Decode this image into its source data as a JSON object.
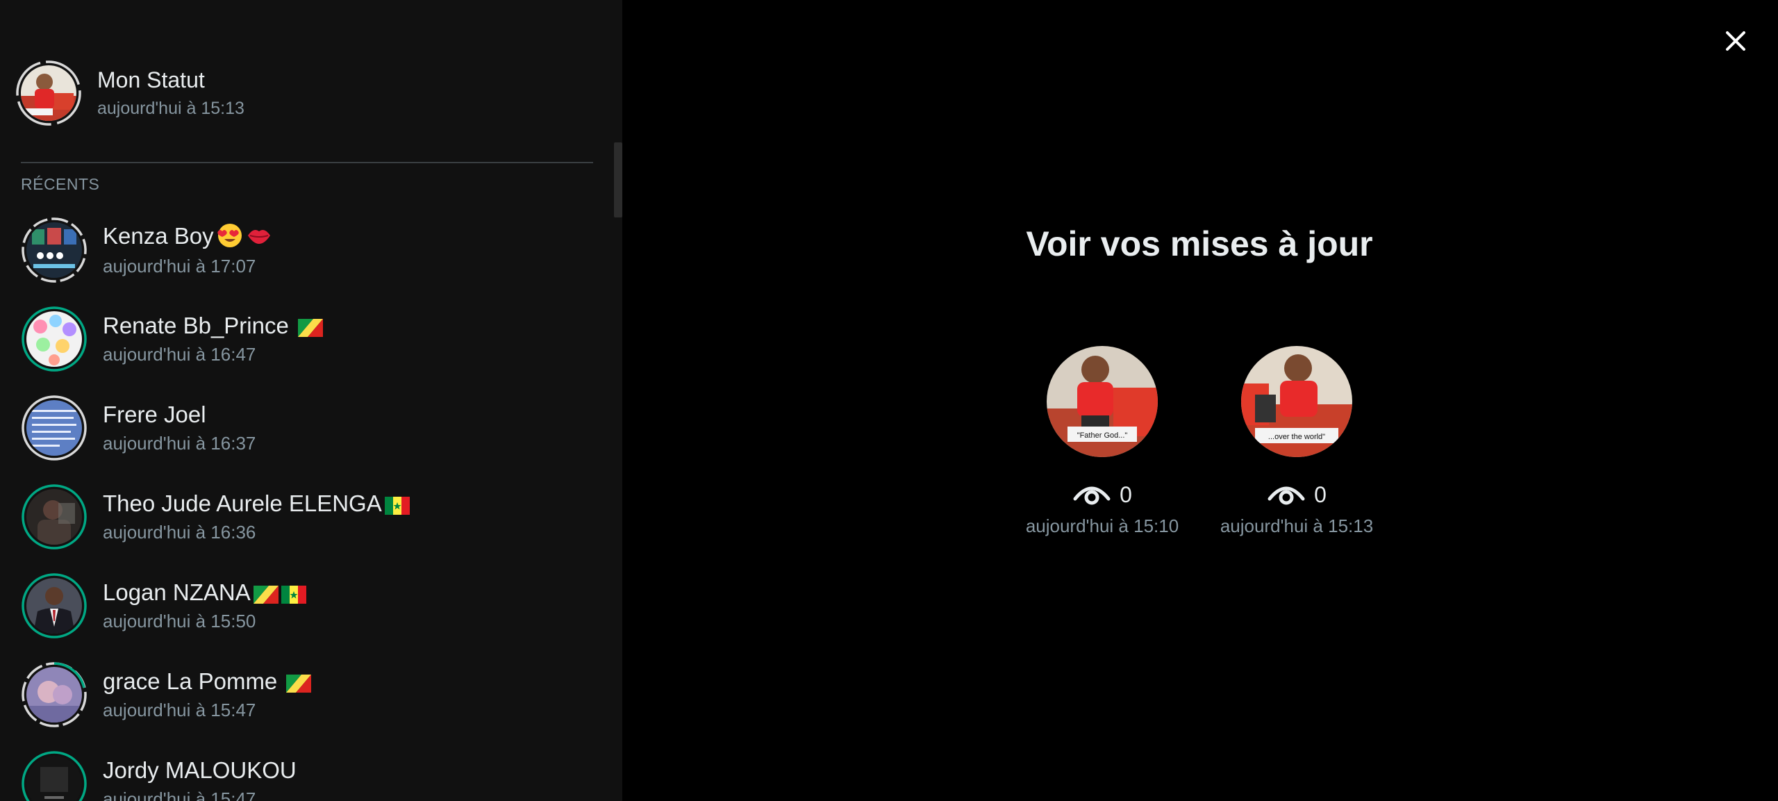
{
  "my_status": {
    "name": "Mon Statut",
    "time": "aujourd'hui à 15:13"
  },
  "section_label": "RÉCENTS",
  "contacts": [
    {
      "name": "Kenza Boy",
      "time": "aujourd'hui à 17:07",
      "emojis": [
        "heart-eyes-emoji",
        "lips-emoji"
      ],
      "ring": "seen"
    },
    {
      "name": "Renate Bb_Prince ",
      "time": "aujourd'hui à 16:47",
      "emojis": [
        "congo-flag"
      ],
      "ring": "unseen"
    },
    {
      "name": "Frere Joel",
      "time": "aujourd'hui à 16:37",
      "emojis": [],
      "ring": "seen"
    },
    {
      "name": "Theo Jude Aurele ELENGA",
      "time": "aujourd'hui à 16:36",
      "emojis": [
        "senegal-flag"
      ],
      "ring": "unseen"
    },
    {
      "name": "Logan NZANA",
      "time": "aujourd'hui à 15:50",
      "emojis": [
        "congo-flag",
        "senegal-flag"
      ],
      "ring": "unseen"
    },
    {
      "name": "grace La Pomme ",
      "time": "aujourd'hui à 15:47",
      "emojis": [
        "congo-flag"
      ],
      "ring": "partial"
    },
    {
      "name": "Jordy MALOUKOU",
      "time": "aujourd'hui à 15:47",
      "emojis": [],
      "ring": "unseen"
    }
  ],
  "main": {
    "heading": "Voir vos mises à jour",
    "updates": [
      {
        "caption": "\"Father God...\"",
        "views": "0",
        "time": "aujourd'hui à 15:10"
      },
      {
        "caption": "...over the world\"",
        "views": "0",
        "time": "aujourd'hui à 15:13"
      }
    ]
  },
  "icons": {
    "close": "close-icon",
    "views": "eye-icon"
  },
  "colors": {
    "unseen_ring": "#00a884",
    "seen_ring": "#d9d9d9",
    "panel_bg": "#111111",
    "secondary_text": "#8696a0"
  }
}
